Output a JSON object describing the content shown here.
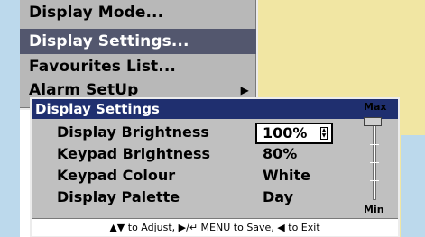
{
  "menu": {
    "items": [
      {
        "label": "Display Mode..."
      },
      {
        "label": "Display Settings...",
        "selected": true
      },
      {
        "label": "Favourites List..."
      },
      {
        "label": "Alarm SetUp",
        "has_submenu": true
      }
    ]
  },
  "dialog": {
    "title": "Display Settings",
    "rows": [
      {
        "label": "Display Brightness",
        "value": "100%"
      },
      {
        "label": "Keypad Brightness",
        "value": "80%"
      },
      {
        "label": "Keypad Colour",
        "value": "White"
      },
      {
        "label": "Display Palette",
        "value": "Day"
      }
    ],
    "slider": {
      "max_label": "Max",
      "min_label": "Min",
      "level": 1.0
    },
    "footer": "▲▼ to Adjust, ▶/↵ MENU to Save, ◀ to Exit"
  },
  "colors": {
    "menu_bg": "#b8b8b8",
    "menu_selected": "#53576e",
    "dialog_title": "#1f2f6f",
    "land": "#f1e6a3",
    "sea": "#bcd9ec"
  }
}
